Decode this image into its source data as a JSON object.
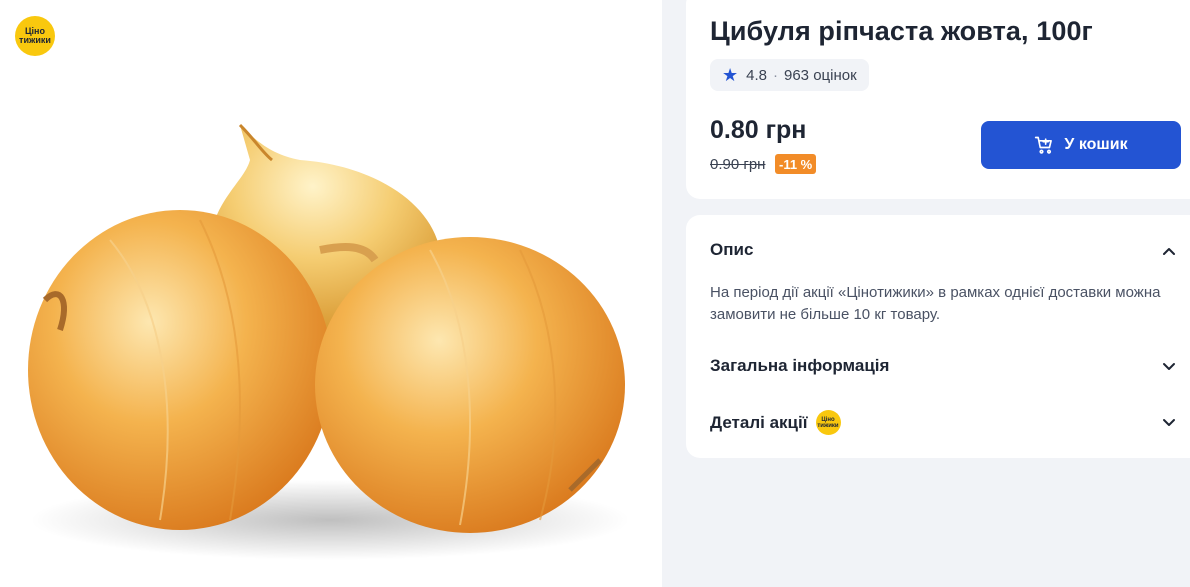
{
  "promo_logo": {
    "line1": "Ціно",
    "line2": "тижики"
  },
  "product": {
    "title": "Цибуля ріпчаста жовта, 100г",
    "rating_value": "4.8",
    "rating_separator": "·",
    "rating_count": "963 оцінок",
    "price": "0.80 грн",
    "old_price": "0.90 грн",
    "discount": "-11 %",
    "add_to_cart_label": "У кошик"
  },
  "sections": {
    "description_title": "Опис",
    "description_text": "На період дії акції «Цінотижики» в рамках однієї доставки можна замовити не більше 10 кг товару.",
    "general_info_title": "Загальна інформація",
    "promo_details_title": "Деталі акції"
  },
  "colors": {
    "accent": "#2354d3",
    "discount": "#f28c28",
    "promo_yellow": "#f9c80e"
  },
  "icons": [
    "star-icon",
    "cart-icon",
    "chevron-up-icon",
    "chevron-down-icon"
  ]
}
